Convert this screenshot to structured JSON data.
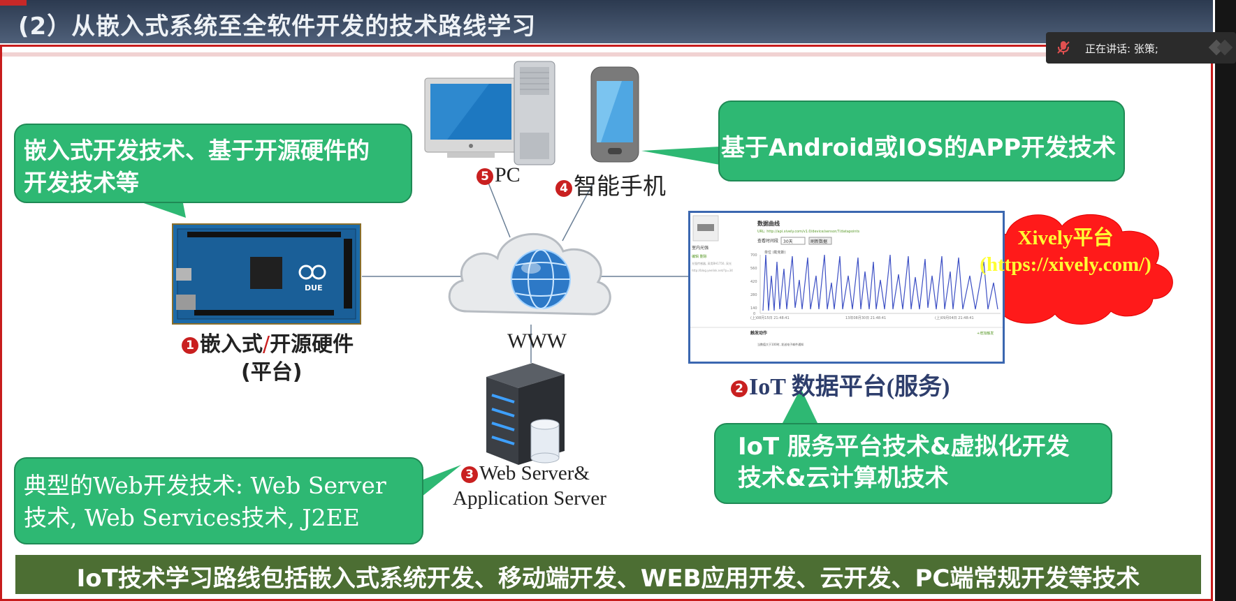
{
  "title": "(2）从嵌入式系统至全软件开发的技术路线学习",
  "speaker_overlay": {
    "text": "正在讲话: 张策;",
    "mic_icon": "muted-mic-icon"
  },
  "callouts": {
    "embedded": {
      "line1": "嵌入式开发技术、基于开源硬件的",
      "line2": "开发技术等"
    },
    "app": {
      "text": "基于Android或IOS的APP开发技术"
    },
    "web": {
      "line1": "典型的Web开发技术: Web Server",
      "line2": "技术, Web Services技术, J2EE"
    },
    "iot": {
      "line1": "IoT 服务平台技术&虚拟化开发",
      "line2": "技术&云计算机技术"
    }
  },
  "nodes": {
    "pc": {
      "num": "5",
      "label": "PC"
    },
    "phone": {
      "num": "4",
      "label": "智能手机"
    },
    "embedded": {
      "num": "1",
      "label_a": "嵌入式",
      "label_sep": "/",
      "label_b": "开源硬件",
      "label_c": "(平台)",
      "board_text": "DUE"
    },
    "iot_platform": {
      "num": "2",
      "label": "IoT 数据平台(服务)"
    },
    "server": {
      "num": "3",
      "line1": "Web Server&",
      "line2": "Application Server"
    },
    "www": {
      "label": "WWW"
    }
  },
  "xively": {
    "line1": "Xively平台",
    "line2": "(https://xively.com/)",
    "cloud_color": "#ff1a1a",
    "text_color": "#ffff33"
  },
  "banner": {
    "text": "IoT技术学习路线包括嵌入式系统开发、移动端开发、WEB应用开发、云开发、PC端常规开发等技术"
  },
  "screenshot": {
    "heading": "数据曲线",
    "url": "URL: http://api.xively.com/v1.0/device/sensor/7/datapoints",
    "select_label": "查看时间段",
    "select_value": "30天",
    "button": "刷新数据",
    "side_title": "室内光强",
    "side_links": "编辑 删除",
    "side_note_1": "光强传感器, 采用BH1750, 采光",
    "side_note_2": "http://blog.yeelink.net/?p=34",
    "y_label": "单位 (勒克斯)",
    "y_ticks": [
      "700",
      "560",
      "420",
      "280",
      "140",
      "0"
    ],
    "x_ticks": [
      "(上)08月15日 21:48:41",
      "13年08月30日 21:48:41",
      "(上)09月04日 21:48:41"
    ],
    "footer_title": "触发动作",
    "footer_link": "+增加触发",
    "footer_note": "当数值大于100时, 发送电子邮件通知"
  },
  "colors": {
    "callout_green": "#2eb873",
    "banner_green": "#4c6e33",
    "title_bg": "#3a4a63",
    "frame_red": "#c71c1c",
    "num_red": "#c92020"
  }
}
